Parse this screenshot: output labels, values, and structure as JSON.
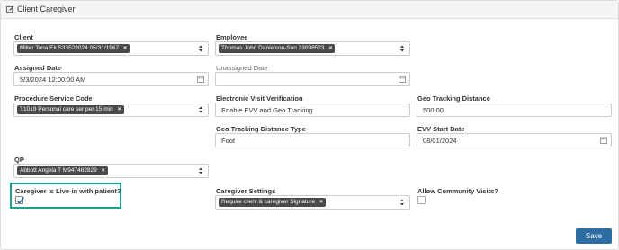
{
  "panel": {
    "title": "Client Caregiver"
  },
  "client": {
    "label": "Client",
    "tag": "Miller Tona Ek S33522024 05/31/1967"
  },
  "employee": {
    "label": "Employee",
    "tag": "Thomas John Danielson-Son 23098523"
  },
  "assigned_date": {
    "label": "Assigned Date",
    "value": "5/3/2024 12:00:00 AM"
  },
  "unassigned_date": {
    "label": "Unassigned Date",
    "value": ""
  },
  "procedure_service_code": {
    "label": "Procedure Service Code",
    "tag": "T1019 Personal care ser per 15 min"
  },
  "evv": {
    "label": "Electronic Visit Verification",
    "value": "Enable EVV and Geo Tracking"
  },
  "geo_tracking_distance": {
    "label": "Geo Tracking Distance",
    "value": "500.00"
  },
  "geo_tracking_distance_type": {
    "label": "Geo Tracking Distance Type",
    "value": "Foot"
  },
  "evv_start_date": {
    "label": "EVV Start Date",
    "value": "08/01/2024"
  },
  "qp": {
    "label": "QP",
    "tag": "Abbott Angela T M947462829"
  },
  "live_in": {
    "label": "Caregiver is Live-in with patient?",
    "checked": true
  },
  "caregiver_settings": {
    "label": "Caregiver Settings",
    "tag": "Require client & caregiver Signature"
  },
  "community_visits": {
    "label": "Allow Community Visits?",
    "checked": false
  },
  "actions": {
    "save_label": "Save"
  },
  "colors": {
    "highlight": "#1aa38c",
    "save_button": "#2e6da4",
    "tag_bg": "#4a4a4a"
  },
  "icons": {
    "header": "edit-icon",
    "remove": "×"
  }
}
